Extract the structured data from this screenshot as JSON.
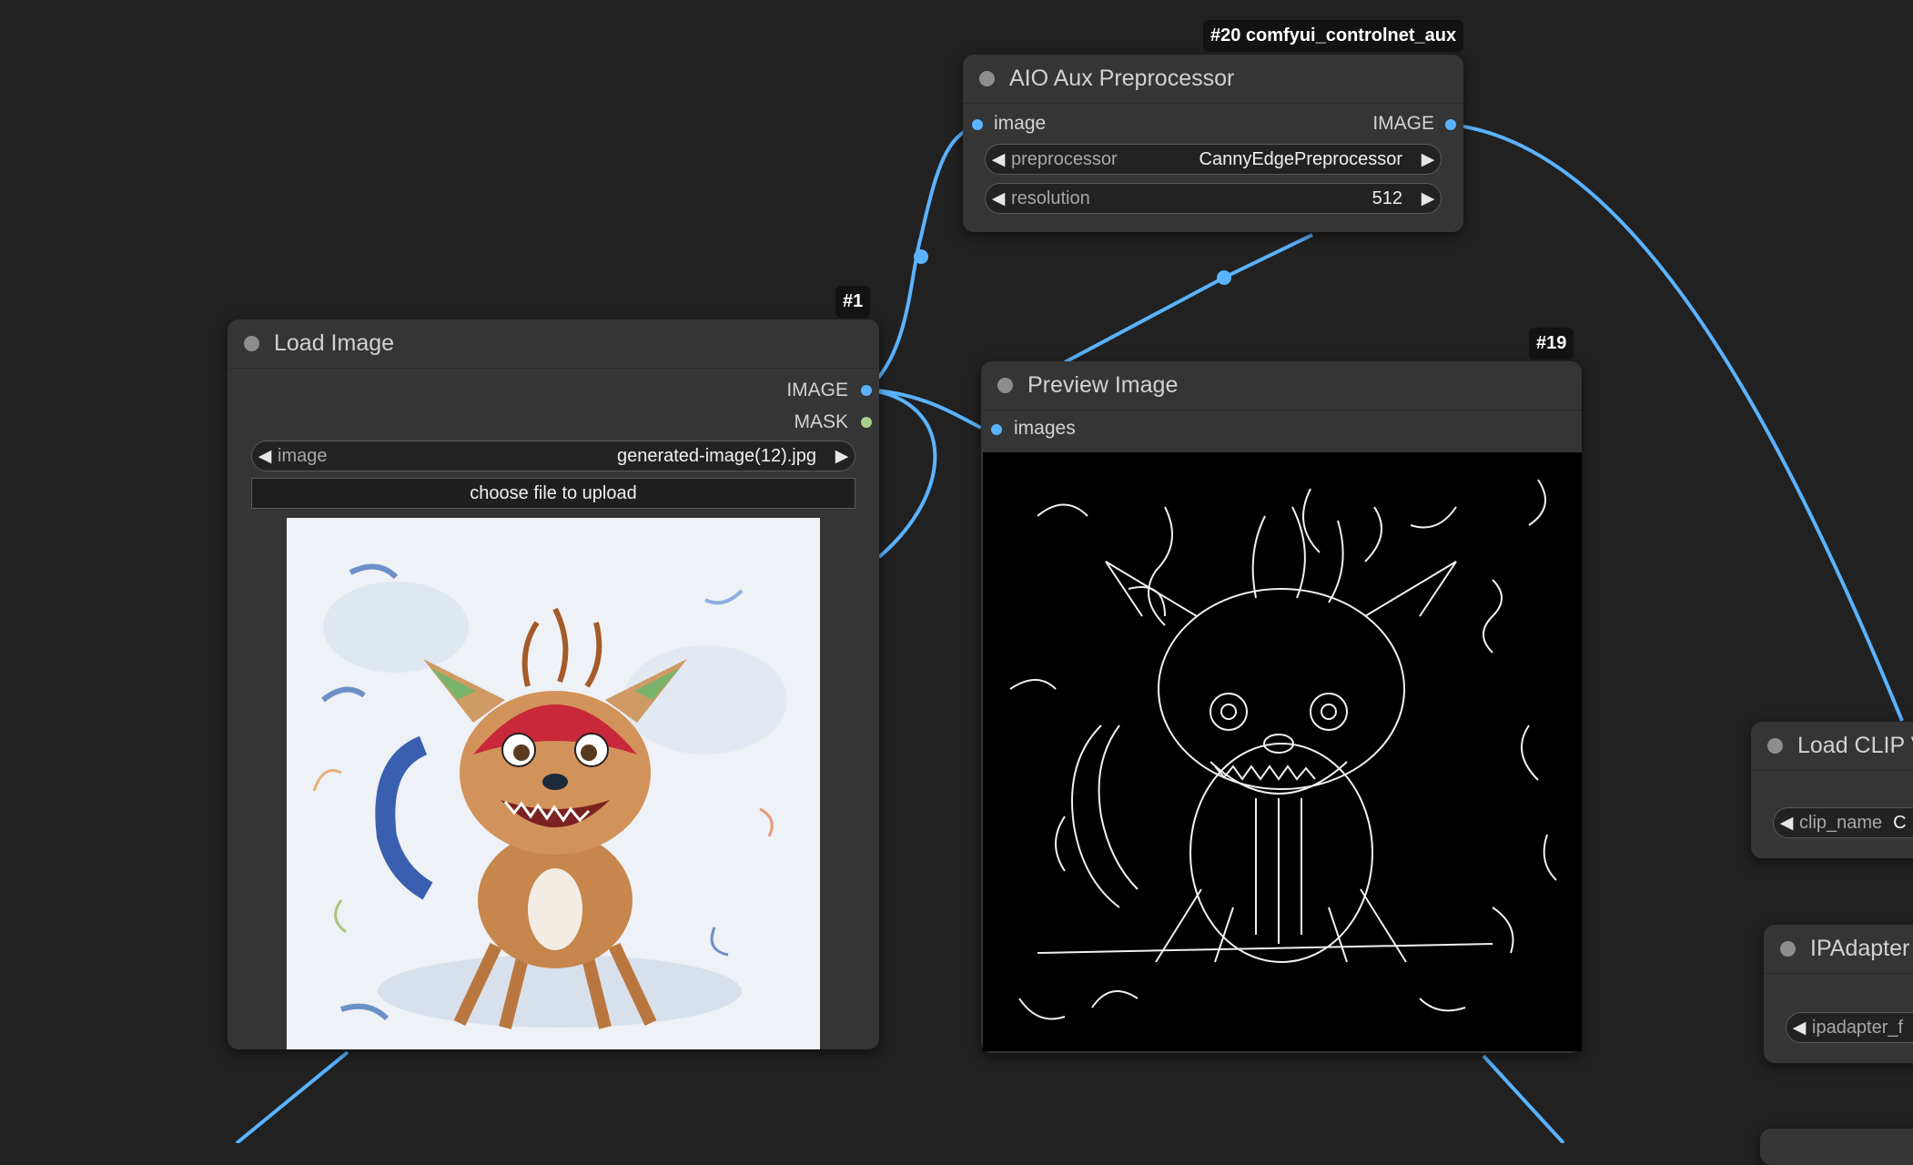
{
  "wire_color": "#5ab3ff",
  "aio_node": {
    "badge": "#20 comfyui_controlnet_aux",
    "title": "AIO Aux Preprocessor",
    "input_label": "image",
    "output_label": "IMAGE",
    "preprocessor": {
      "label": "preprocessor",
      "value": "CannyEdgePreprocessor"
    },
    "resolution": {
      "label": "resolution",
      "value": "512"
    }
  },
  "load_image_node": {
    "badge": "#1",
    "title": "Load Image",
    "outputs": {
      "image": "IMAGE",
      "mask": "MASK"
    },
    "image_widget": {
      "label": "image",
      "value": "generated-image(12).jpg"
    },
    "upload_label": "choose file to upload"
  },
  "preview_node": {
    "badge": "#19",
    "title": "Preview Image",
    "input_label": "images"
  },
  "load_clip_node": {
    "title": "Load CLIP V",
    "widget": {
      "label": "clip_name",
      "value": "C"
    }
  },
  "ipadapter_node": {
    "title": "IPAdapter",
    "widget": {
      "label": "ipadapter_f"
    }
  }
}
